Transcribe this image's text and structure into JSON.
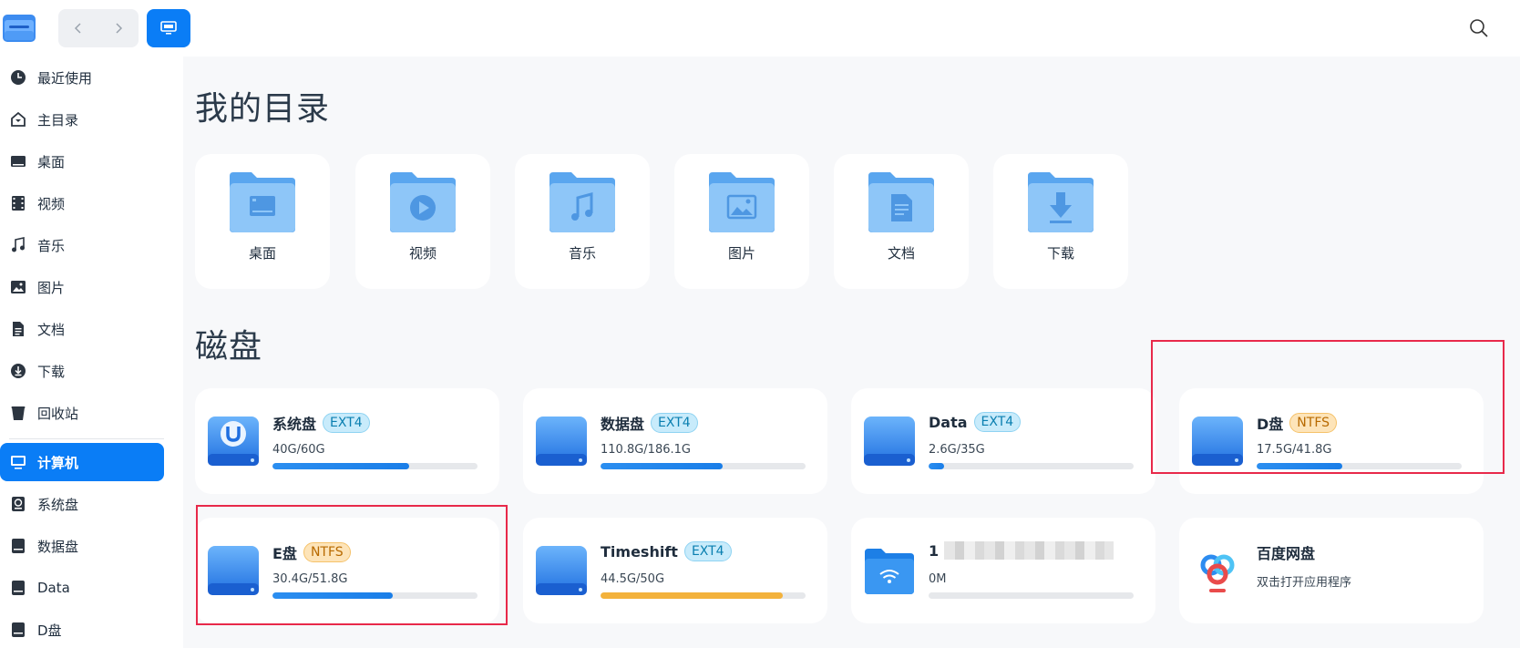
{
  "header": {
    "nav_back": "back",
    "nav_forward": "forward"
  },
  "sidebar": {
    "items": [
      {
        "label": "最近使用",
        "icon": "clock-icon"
      },
      {
        "label": "主目录",
        "icon": "home-icon"
      },
      {
        "label": "桌面",
        "icon": "desktop-icon"
      },
      {
        "label": "视频",
        "icon": "film-icon"
      },
      {
        "label": "音乐",
        "icon": "music-icon"
      },
      {
        "label": "图片",
        "icon": "image-icon"
      },
      {
        "label": "文档",
        "icon": "document-icon"
      },
      {
        "label": "下载",
        "icon": "download-icon"
      },
      {
        "label": "回收站",
        "icon": "trash-icon"
      },
      {
        "label": "计算机",
        "icon": "computer-icon",
        "active": true
      },
      {
        "label": "系统盘",
        "icon": "system-disk-icon"
      },
      {
        "label": "数据盘",
        "icon": "disk-icon"
      },
      {
        "label": "Data",
        "icon": "disk-icon"
      },
      {
        "label": "D盘",
        "icon": "disk-icon"
      }
    ]
  },
  "main": {
    "my_dirs_title": "我的目录",
    "disks_title": "磁盘",
    "folders": [
      {
        "label": "桌面",
        "icon": "desktop-folder-icon"
      },
      {
        "label": "视频",
        "icon": "video-folder-icon"
      },
      {
        "label": "音乐",
        "icon": "music-folder-icon"
      },
      {
        "label": "图片",
        "icon": "picture-folder-icon"
      },
      {
        "label": "文档",
        "icon": "document-folder-icon"
      },
      {
        "label": "下载",
        "icon": "download-folder-icon"
      }
    ],
    "disks": [
      {
        "name": "系统盘",
        "fs": "EXT4",
        "usage": "40G/60G",
        "used_fraction": 0.667
      },
      {
        "name": "数据盘",
        "fs": "EXT4",
        "usage": "110.8G/186.1G",
        "used_fraction": 0.595
      },
      {
        "name": "Data",
        "fs": "EXT4",
        "usage": "2.6G/35G",
        "used_fraction": 0.074
      },
      {
        "name": "D盘",
        "fs": "NTFS",
        "usage": "17.5G/41.8G",
        "used_fraction": 0.419
      },
      {
        "name": "E盘",
        "fs": "NTFS",
        "usage": "30.4G/51.8G",
        "used_fraction": 0.587
      },
      {
        "name": "Timeshift",
        "fs": "EXT4",
        "usage": "44.5G/50G",
        "used_fraction": 0.89
      },
      {
        "name": "1",
        "fs": "",
        "usage": "0M",
        "used_fraction": 0.0
      },
      {
        "name": "百度网盘",
        "fs": "",
        "usage": "双击打开应用程序"
      }
    ]
  },
  "colors": {
    "accent": "#0a7df6",
    "highlight": "#e8294a",
    "warn": "#f3b23c"
  }
}
